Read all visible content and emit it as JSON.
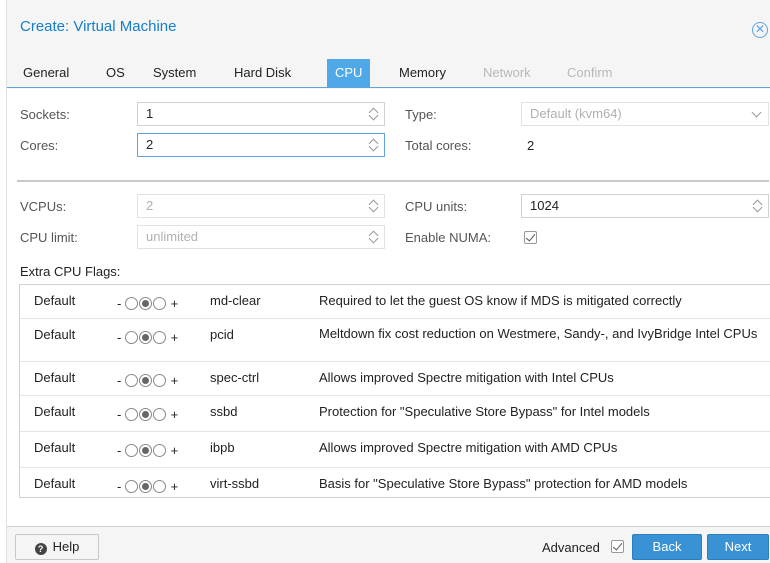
{
  "window": {
    "title": "Create: Virtual Machine"
  },
  "tabs": [
    {
      "label": "General",
      "state": "normal"
    },
    {
      "label": "OS",
      "state": "normal"
    },
    {
      "label": "System",
      "state": "normal"
    },
    {
      "label": "Hard Disk",
      "state": "normal"
    },
    {
      "label": "CPU",
      "state": "active"
    },
    {
      "label": "Memory",
      "state": "normal"
    },
    {
      "label": "Network",
      "state": "disabled"
    },
    {
      "label": "Confirm",
      "state": "disabled"
    }
  ],
  "form": {
    "sockets": {
      "label": "Sockets:",
      "value": "1"
    },
    "cores": {
      "label": "Cores:",
      "value": "2"
    },
    "type": {
      "label": "Type:",
      "value": "Default (kvm64)"
    },
    "total_cores": {
      "label": "Total cores:",
      "value": "2"
    },
    "vcpus": {
      "label": "VCPUs:",
      "value": "2"
    },
    "cpu_units": {
      "label": "CPU units:",
      "value": "1024"
    },
    "cpu_limit": {
      "label": "CPU limit:",
      "value": "unlimited"
    },
    "enable_numa": {
      "label": "Enable NUMA:",
      "checked": true
    }
  },
  "extra_flags": {
    "label": "Extra CPU Flags:",
    "minus": "-",
    "plus": "+",
    "rows": [
      {
        "state": "Default",
        "flag": "md-clear",
        "description": "Required to let the guest OS know if MDS is mitigated correctly"
      },
      {
        "state": "Default",
        "flag": "pcid",
        "description": "Meltdown fix cost reduction on Westmere, Sandy-, and IvyBridge Intel CPUs"
      },
      {
        "state": "Default",
        "flag": "spec-ctrl",
        "description": "Allows improved Spectre mitigation with Intel CPUs"
      },
      {
        "state": "Default",
        "flag": "ssbd",
        "description": "Protection for \"Speculative Store Bypass\" for Intel models"
      },
      {
        "state": "Default",
        "flag": "ibpb",
        "description": "Allows improved Spectre mitigation with AMD CPUs"
      },
      {
        "state": "Default",
        "flag": "virt-ssbd",
        "description": "Basis for \"Speculative Store Bypass\" protection for AMD models"
      }
    ]
  },
  "footer": {
    "help_label": "Help",
    "advanced_label": "Advanced",
    "advanced_checked": true,
    "back_label": "Back",
    "next_label": "Next"
  }
}
